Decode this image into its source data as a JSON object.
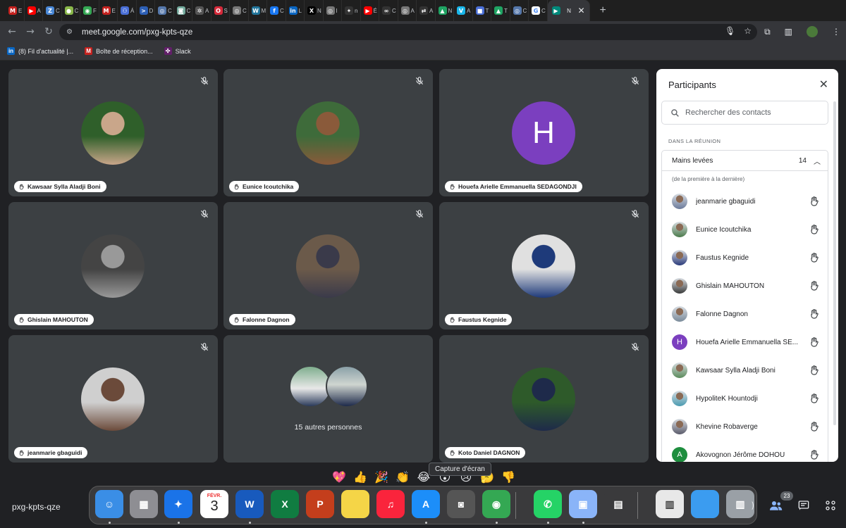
{
  "browser": {
    "tabs": [
      {
        "icon": "gmail-icon",
        "label": "M",
        "color": "#c5221f",
        "text": "E"
      },
      {
        "icon": "youtube-icon",
        "label": "▶",
        "color": "#ff0000",
        "text": "A"
      },
      {
        "icon": "z-icon",
        "label": "Z",
        "color": "#4a88d6",
        "text": "C"
      },
      {
        "icon": "circle-icon",
        "label": "●",
        "color": "#8ab84a",
        "text": "C"
      },
      {
        "icon": "maps-icon",
        "label": "◉",
        "color": "#34a853",
        "text": "F"
      },
      {
        "icon": "gmail-icon",
        "label": "M",
        "color": "#c5221f",
        "text": "E"
      },
      {
        "icon": "people-icon",
        "label": "⚇",
        "color": "#4a6fd6",
        "text": "Á"
      },
      {
        "icon": "code-icon",
        "label": ">",
        "color": "#2d5fb5",
        "text": "D"
      },
      {
        "icon": "globe-icon",
        "label": "◎",
        "color": "#5577aa",
        "text": "C"
      },
      {
        "icon": "chat-icon",
        "label": "◙",
        "color": "#74aa9c",
        "text": "C"
      },
      {
        "icon": "cog-icon",
        "label": "✲",
        "color": "#555555",
        "text": "A"
      },
      {
        "icon": "opera-icon",
        "label": "O",
        "color": "#d62a3a",
        "text": "S"
      },
      {
        "icon": "globe-icon",
        "label": "◎",
        "color": "#777777",
        "text": "C"
      },
      {
        "icon": "wordpress-icon",
        "label": "W",
        "color": "#21759b",
        "text": "M"
      },
      {
        "icon": "facebook-icon",
        "label": "f",
        "color": "#1877f2",
        "text": "C"
      },
      {
        "icon": "linkedin-icon",
        "label": "in",
        "color": "#0a66c2",
        "text": "L"
      },
      {
        "icon": "x-icon",
        "label": "X",
        "color": "#000000",
        "text": "N"
      },
      {
        "icon": "globe-icon",
        "label": "◎",
        "color": "#777777",
        "text": "I"
      },
      {
        "icon": "star-icon",
        "label": "✦",
        "color": "#333333",
        "text": "n"
      },
      {
        "icon": "youtube-icon",
        "label": "▶",
        "color": "#ff0000",
        "text": "É"
      },
      {
        "icon": "link-icon",
        "label": "∞",
        "color": "#333333",
        "text": "C"
      },
      {
        "icon": "globe-icon",
        "label": "◎",
        "color": "#777777",
        "text": "A"
      },
      {
        "icon": "arrows-icon",
        "label": "⇄",
        "color": "#333333",
        "text": "A"
      },
      {
        "icon": "drive-icon",
        "label": "▲",
        "color": "#1fa463",
        "text": "N"
      },
      {
        "icon": "vimeo-icon",
        "label": "V",
        "color": "#1ab7ea",
        "text": "A"
      },
      {
        "icon": "bookmark-icon",
        "label": "■",
        "color": "#4a6fd6",
        "text": "T"
      },
      {
        "icon": "drive-icon",
        "label": "▲",
        "color": "#1fa463",
        "text": "T"
      },
      {
        "icon": "globe-icon",
        "label": "◎",
        "color": "#5577aa",
        "text": "C"
      },
      {
        "icon": "google-icon",
        "label": "G",
        "color": "#ffffff",
        "text": "C"
      }
    ],
    "active_tab": {
      "icon": "meet-icon",
      "label": "▶",
      "color": "#00897b",
      "text": "N"
    },
    "url": "meet.google.com/pxg-kpts-qze",
    "bookmarks": [
      {
        "icon": "linkedin-icon",
        "label": "in",
        "color": "#0a66c2",
        "text": "(8) Fil d'actualité |..."
      },
      {
        "icon": "gmail-icon",
        "label": "M",
        "color": "#c5221f",
        "text": "Boîte de réception..."
      },
      {
        "icon": "slack-icon",
        "label": "✣",
        "color": "#611f69",
        "text": "Slack"
      }
    ]
  },
  "meet": {
    "tiles": [
      {
        "name": "Kawsaar Sylla Aladji Boni"
      },
      {
        "name": "Eunice Icoutchika"
      },
      {
        "name": "Houefa Arielle Emmanuella SEDAGONDJI",
        "letter": "H"
      },
      {
        "name": "Ghislain MAHOUTON"
      },
      {
        "name": "Falonne Dagnon"
      },
      {
        "name": "Faustus Kegnide"
      },
      {
        "name": "jeanmarie gbaguidi"
      },
      {
        "others": "15 autres personnes"
      },
      {
        "name": "Koto Daniel DAGNON"
      }
    ],
    "meeting_code": "pxg-kpts-qze",
    "tooltip": "Capture d'écran",
    "reactions": [
      "💖",
      "👍",
      "🎉",
      "👏",
      "😂",
      "😮",
      "😢",
      "🤔",
      "👎"
    ],
    "participants_badge": "23"
  },
  "participants_panel": {
    "title": "Participants",
    "search_placeholder": "Rechercher des contacts",
    "section": "DANS LA RÉUNION",
    "group_label": "Mains levées",
    "group_count": "14",
    "order_note": "(de la première à la dernière)",
    "people": [
      {
        "name": "jeanmarie gbaguidi"
      },
      {
        "name": "Eunice Icoutchika"
      },
      {
        "name": "Faustus Kegnide"
      },
      {
        "name": "Ghislain MAHOUTON"
      },
      {
        "name": "Falonne Dagnon"
      },
      {
        "name": "Houefa Arielle Emmanuella SE...",
        "letter": "H",
        "color": "#7b3fbf"
      },
      {
        "name": "Kawsaar Sylla Aladji Boni"
      },
      {
        "name": "HypoliteK Hountodji"
      },
      {
        "name": "Khevine Robaverge"
      },
      {
        "name": "Akovognon Jérôme DOHOU",
        "letter": "A",
        "color": "#1e8e3e"
      }
    ]
  },
  "dock": {
    "calendar_month": "FÉVR.",
    "calendar_day": "3",
    "apps": [
      {
        "icon": "finder-icon",
        "label": "☺",
        "color": "#3a8ee6"
      },
      {
        "icon": "launchpad-icon",
        "label": "▦",
        "color": "#8e8e93"
      },
      {
        "icon": "safari-icon",
        "label": "✦",
        "color": "#1a73e8"
      },
      {
        "icon": "calendar-icon",
        "label": "",
        "color": "#ffffff"
      },
      {
        "icon": "word-icon",
        "label": "W",
        "color": "#185abd"
      },
      {
        "icon": "excel-icon",
        "label": "X",
        "color": "#107c41"
      },
      {
        "icon": "powerpoint-icon",
        "label": "P",
        "color": "#c43e1c"
      },
      {
        "icon": "notes-icon",
        "label": "",
        "color": "#f5d547"
      },
      {
        "icon": "music-icon",
        "label": "♫",
        "color": "#fa243c"
      },
      {
        "icon": "appstore-icon",
        "label": "A",
        "color": "#1c8ef9"
      },
      {
        "icon": "screenshot-icon",
        "label": "◙",
        "color": "#555555"
      },
      {
        "icon": "chrome-icon",
        "label": "◉",
        "color": "#34a853"
      },
      {
        "icon": "whatsapp-icon",
        "label": "✆",
        "color": "#25d366"
      },
      {
        "icon": "preview-icon",
        "label": "▣",
        "color": "#8ab4f8"
      },
      {
        "icon": "calculator-icon",
        "label": "▤",
        "color": "#3a3a3c"
      },
      {
        "icon": "document-icon",
        "label": "▥",
        "color": "#e8e8e8"
      },
      {
        "icon": "folder-icon",
        "label": "",
        "color": "#3b9cf0"
      },
      {
        "icon": "trash-icon",
        "label": "▥",
        "color": "#9aa0a6"
      }
    ]
  }
}
